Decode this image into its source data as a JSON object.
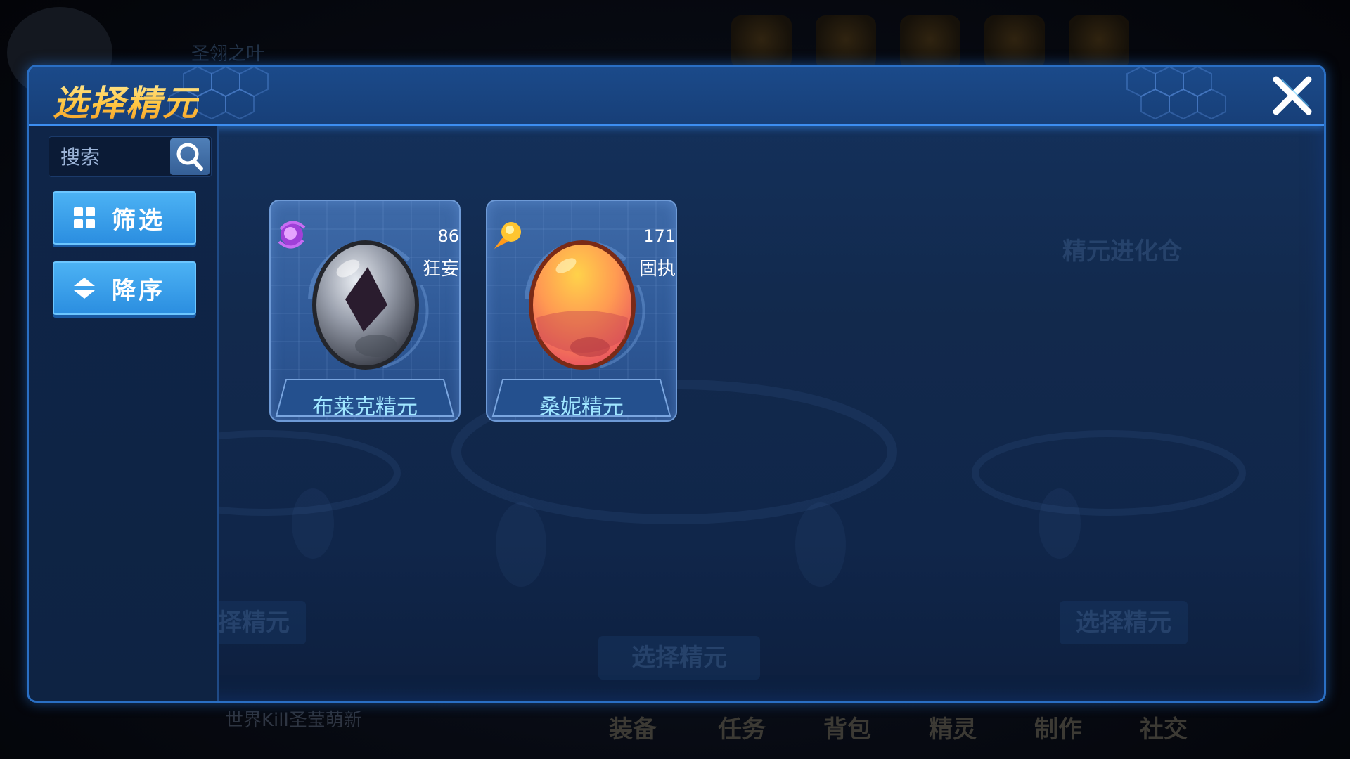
{
  "background": {
    "top_title": "圣翎之叶",
    "world_text": "世界Kill圣莹萌新",
    "bottom_tabs": [
      "装备",
      "任务",
      "背包",
      "精灵",
      "制作",
      "社交"
    ],
    "ghost_buttons": [
      "选择精元",
      "选择精元",
      "选择精元"
    ],
    "ghost_header": "精元进化仓"
  },
  "panel": {
    "title": "选择精元",
    "close_icon": "close-x-icon"
  },
  "sidebar": {
    "search": {
      "placeholder": "搜索",
      "value": ""
    },
    "filter_label": "筛选",
    "sort_label": "降序"
  },
  "cards": [
    {
      "name": "布莱克精元",
      "level": "86",
      "nature": "狂妄",
      "type_icon": "purple-orb-icon",
      "egg_color": "#8a8f9c",
      "type_color": "#b04ee0"
    },
    {
      "name": "桑妮精元",
      "level": "171",
      "nature": "固执",
      "type_icon": "yellow-comet-icon",
      "egg_color": "#ff8a4a",
      "type_color": "#ffc530"
    }
  ],
  "colors": {
    "accent": "#2b8ee0",
    "title_gold": "#ffc845",
    "card_name": "#9fe6ff"
  }
}
